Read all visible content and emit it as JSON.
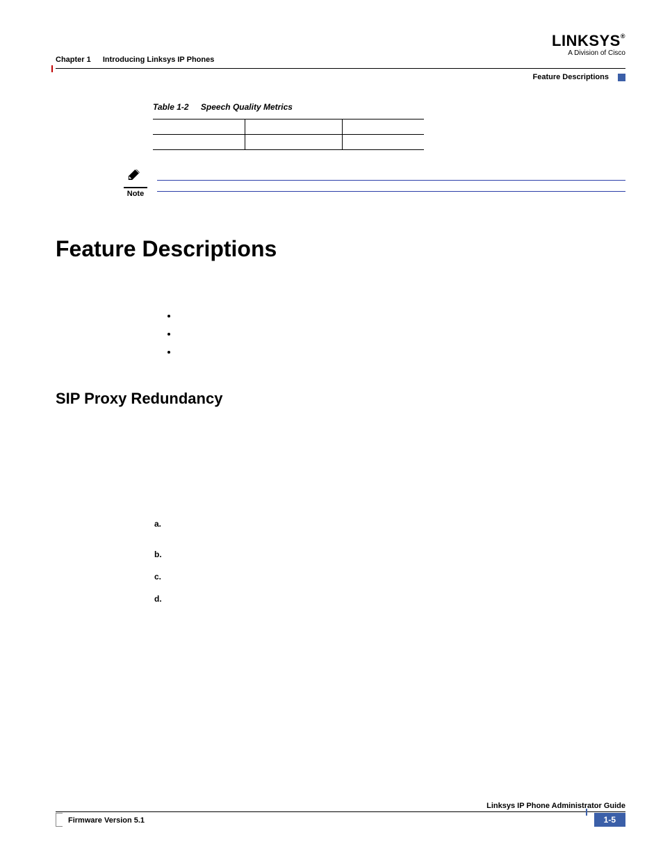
{
  "header": {
    "logo": "LINKSYS",
    "logo_reg": "®",
    "logo_sub": "A Division of Cisco",
    "chapter_num": "Chapter 1",
    "chapter_title": "Introducing Linksys IP Phones",
    "section_label": "Feature Descriptions"
  },
  "table": {
    "number": "Table 1-2",
    "title": "Speech Quality Metrics"
  },
  "note": {
    "label": "Note"
  },
  "headings": {
    "h1": "Feature Descriptions",
    "h2": "SIP Proxy Redundancy"
  },
  "bullets": [
    "",
    "",
    ""
  ],
  "ordered": {
    "items": [
      {
        "marker": "a."
      },
      {
        "marker": "b."
      },
      {
        "marker": "c."
      },
      {
        "marker": "d."
      }
    ]
  },
  "footer": {
    "guide": "Linksys IP Phone Administrator Guide",
    "firmware": "Firmware Version 5.1",
    "page": "1-5"
  }
}
